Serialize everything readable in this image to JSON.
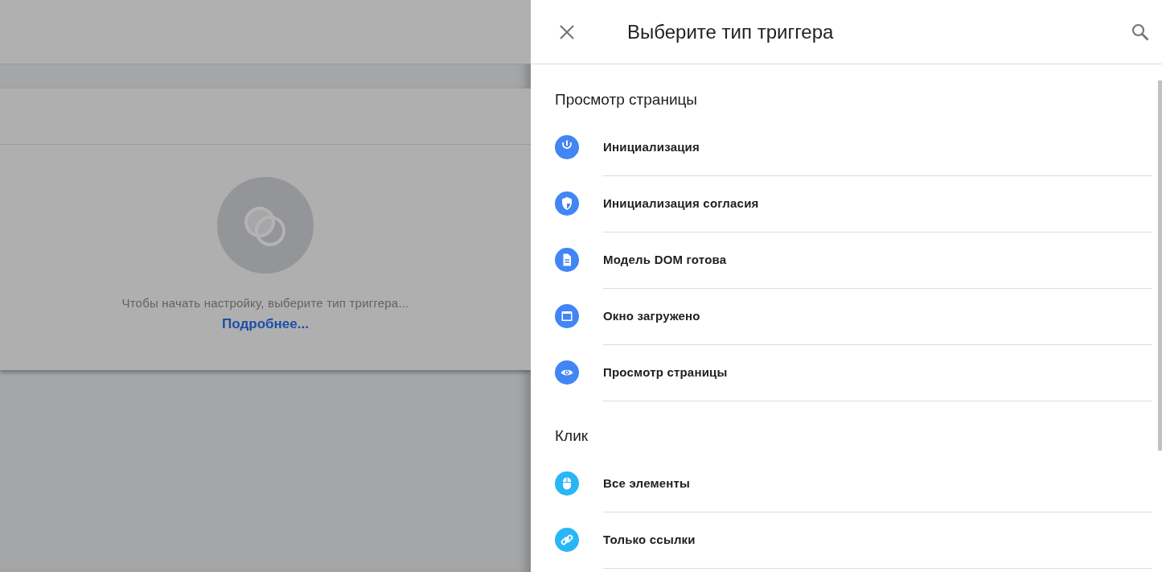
{
  "background": {
    "empty_state": {
      "message": "Чтобы начать настройку, выберите тип триггера...",
      "link": "Подробнее..."
    }
  },
  "panel": {
    "title": "Выберите тип триггера",
    "sections": [
      {
        "heading": "Просмотр страницы",
        "items": [
          {
            "label": "Инициализация",
            "kind": "power",
            "color": "#4285f4"
          },
          {
            "label": "Инициализация согласия",
            "kind": "shield",
            "color": "#4285f4"
          },
          {
            "label": "Модель DOM готова",
            "kind": "document",
            "color": "#4285f4"
          },
          {
            "label": "Окно загружено",
            "kind": "window",
            "color": "#4285f4"
          },
          {
            "label": "Просмотр страницы",
            "kind": "eye",
            "color": "#4285f4"
          }
        ]
      },
      {
        "heading": "Клик",
        "items": [
          {
            "label": "Все элементы",
            "kind": "mouse",
            "color": "#29b6f6"
          },
          {
            "label": "Только ссылки",
            "kind": "link",
            "color": "#29b6f6"
          }
        ]
      }
    ]
  }
}
